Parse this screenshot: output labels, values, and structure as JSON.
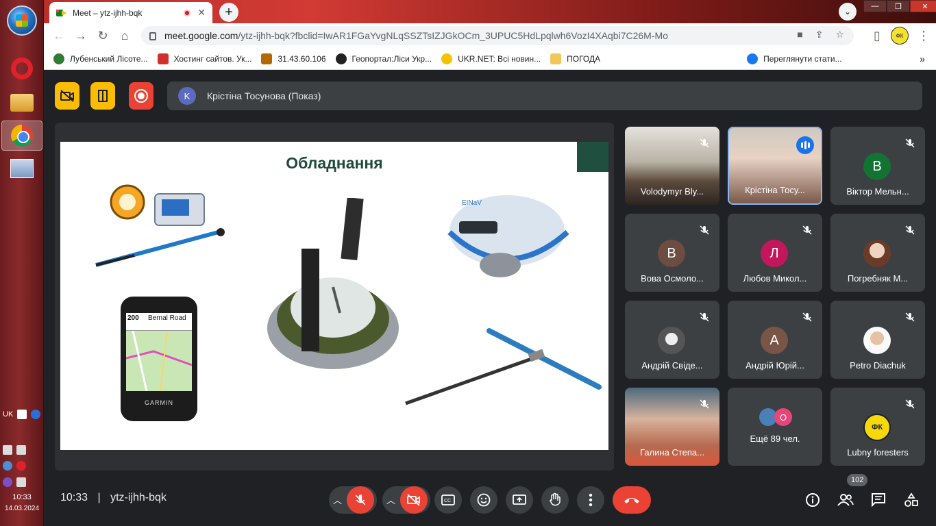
{
  "taskbar": {
    "language": "UK",
    "clock_time": "10:33",
    "clock_date": "14.03.2024"
  },
  "browser": {
    "tab_title": "Meet – ytz-ijhh-bqk",
    "new_tab_icon": "plus-icon",
    "url_domain": "meet.google.com",
    "url_path": "/ytz-ijhh-bqk?fbclid=IwAR1FGaYvgNLqSSZTsIZJGkOCm_3UPUC5HdLpqlwh6VozI4XAqbi7C26M-Mo",
    "profile_text": "ФК",
    "bookmarks": [
      {
        "label": "Лубенський Лісоте...",
        "color": "#2e7d32"
      },
      {
        "label": "Хостинг сайтов. Ук...",
        "color": "#d32f2f"
      },
      {
        "label": "31.43.60.106",
        "color": "#b26a00"
      },
      {
        "label": "Геопортал:Ліси Укр...",
        "color": "#222222"
      },
      {
        "label": "UKR.NET: Всі новин...",
        "color": "#f2c300"
      },
      {
        "label": "ПОГОДА",
        "color": "#f1c75b"
      },
      {
        "label": "Переглянути стати...",
        "color": "#1877f2"
      }
    ],
    "more_bookmarks": "»"
  },
  "meet": {
    "presenter_initial": "K",
    "presenter_label": "Крістіна Тосунова (Показ)",
    "slide_title": "Обладнання",
    "gps_screen_distance": "200",
    "gps_screen_road": "Bernal Road",
    "gps_brand": "GARMIN",
    "receiver_brand": "EINaV",
    "participants": [
      {
        "name": "Volodymyr Bly...",
        "type": "video",
        "muted": true
      },
      {
        "name": "Крістіна Тосу...",
        "type": "video",
        "speaking": true
      },
      {
        "name": "Віктор Мельн...",
        "initial": "В",
        "color": "#137333",
        "muted": true
      },
      {
        "name": "Вова Осмоло...",
        "initial": "В",
        "color": "#6d4c41",
        "muted": true
      },
      {
        "name": "Любов Микол...",
        "initial": "Л",
        "color": "#c2185b",
        "muted": true
      },
      {
        "name": "Погребняк М...",
        "type": "photo",
        "muted": true
      },
      {
        "name": "Андрій Свіде...",
        "type": "photo",
        "muted": true
      },
      {
        "name": "Андрій Юрій...",
        "initial": "А",
        "color": "#795548",
        "muted": true
      },
      {
        "name": "Petro Diachuk",
        "type": "photo",
        "muted": true
      },
      {
        "name": "Галина Степа...",
        "type": "video",
        "muted": true
      },
      {
        "name": "Ещё 89 чел.",
        "type": "more",
        "mini_initial": "О"
      },
      {
        "name": "Lubny foresters",
        "type": "logo",
        "logo_text": "ФК",
        "muted": true
      }
    ],
    "meeting_time": "10:33",
    "separator": "|",
    "meeting_code": "ytz-ijhh-bqk",
    "people_count": "102",
    "accent_red": "#ea4335",
    "accent_yellow": "#fbbc04"
  }
}
